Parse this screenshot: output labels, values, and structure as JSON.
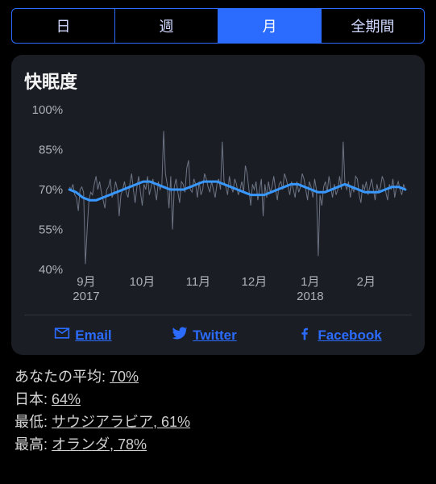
{
  "tabs": {
    "items": [
      {
        "label": "日",
        "active": false
      },
      {
        "label": "週",
        "active": false
      },
      {
        "label": "月",
        "active": true
      },
      {
        "label": "全期間",
        "active": false
      }
    ]
  },
  "card": {
    "title": "快眠度"
  },
  "chart_data": {
    "type": "line",
    "title": "快眠度",
    "ylabel": "",
    "xlabel": "",
    "ylim": [
      40,
      100
    ],
    "y_ticks": [
      "100%",
      "85%",
      "70%",
      "55%",
      "40%"
    ],
    "x_ticks": [
      "9月",
      "10月",
      "11月",
      "12月",
      "1月",
      "2月"
    ],
    "x_tick_sub": {
      "0": "2017",
      "4": "2018"
    },
    "series": [
      {
        "name": "daily",
        "style": "thin-gray",
        "values": [
          71,
          70,
          72,
          68,
          67,
          62,
          70,
          71,
          69,
          42,
          55,
          66,
          69,
          68,
          72,
          75,
          70,
          73,
          69,
          66,
          63,
          70,
          71,
          74,
          67,
          69,
          73,
          70,
          60,
          68,
          70,
          73,
          69,
          67,
          72,
          76,
          70,
          65,
          71,
          75,
          69,
          64,
          72,
          70,
          75,
          68,
          71,
          74,
          70,
          66,
          73,
          70,
          72,
          92,
          76,
          72,
          63,
          75,
          55,
          71,
          74,
          69,
          65,
          73,
          72,
          69,
          78,
          81,
          70,
          69,
          74,
          72,
          67,
          73,
          68,
          70,
          76,
          74,
          71,
          69,
          73,
          70,
          67,
          72,
          74,
          70,
          88,
          73,
          71,
          68,
          75,
          71,
          69,
          74,
          72,
          68,
          70,
          73,
          69,
          79,
          76,
          70,
          64,
          72,
          70,
          73,
          66,
          70,
          74,
          60,
          72,
          67,
          73,
          69,
          71,
          75,
          70,
          66,
          72,
          73,
          70,
          76,
          74,
          71,
          68,
          73,
          70,
          67,
          73,
          69,
          71,
          76,
          74,
          70,
          66,
          73,
          71,
          67,
          74,
          70,
          45,
          68,
          64,
          71,
          73,
          69,
          75,
          71,
          67,
          72,
          68,
          70,
          75,
          70,
          88,
          72,
          70,
          73,
          67,
          71,
          69,
          75,
          74,
          68,
          65,
          72,
          70,
          73,
          68,
          71,
          74,
          70,
          66,
          72,
          69,
          71,
          75,
          73,
          69,
          66,
          72,
          70,
          74,
          67,
          71,
          73,
          70,
          68,
          72,
          70
        ]
      },
      {
        "name": "trend",
        "style": "thick-blue",
        "values": [
          70,
          69,
          67,
          66,
          66,
          67,
          68,
          69,
          70,
          71,
          72,
          73,
          73,
          72,
          71,
          70,
          70,
          70,
          71,
          72,
          73,
          73,
          73,
          72,
          71,
          70,
          69,
          68,
          68,
          68,
          69,
          70,
          71,
          72,
          72,
          71,
          70,
          69,
          69,
          70,
          71,
          72,
          71,
          70,
          69,
          69,
          69,
          70,
          71,
          71,
          70
        ]
      }
    ]
  },
  "share": {
    "email": "Email",
    "twitter": "Twitter",
    "facebook": "Facebook"
  },
  "stats": {
    "your_avg_label": "あなたの平均:",
    "your_avg_value": "70%",
    "japan_label": "日本:",
    "japan_value": "64%",
    "lowest_label": "最低:",
    "lowest_value": "サウジアラビア, 61%",
    "highest_label": "最高:",
    "highest_value": "オランダ, 78%"
  }
}
